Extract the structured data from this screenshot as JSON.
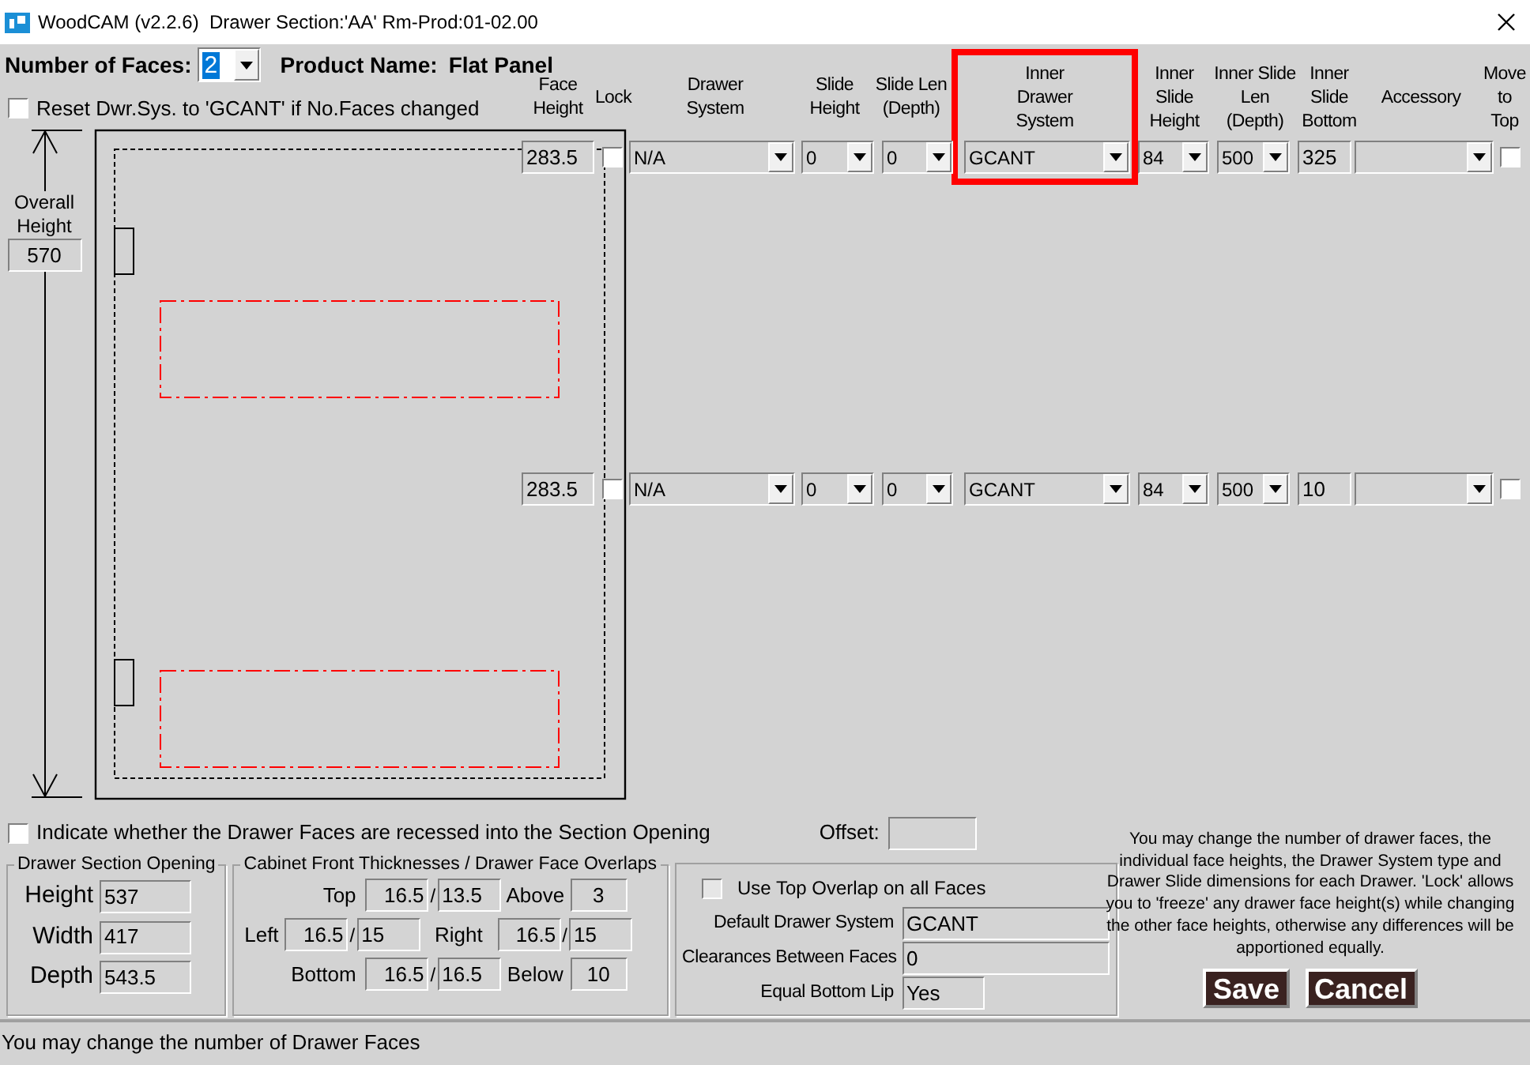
{
  "window": {
    "title": "WoodCAM (v2.2.6)  Drawer Section:'AA' Rm-Prod:01-02.00"
  },
  "number_of_faces": {
    "label": "Number of Faces:",
    "value": "2",
    "focused": true
  },
  "product_name": {
    "label": "Product Name:",
    "value": "Flat Panel"
  },
  "reset_option": {
    "label": "Reset Dwr.Sys. to 'GCANT' if No.Faces changed",
    "checked": false
  },
  "overall_height": {
    "label": "Overall Height",
    "value": "570"
  },
  "columns": [
    {
      "label": "Face\nHeight",
      "highlighted": false
    },
    {
      "label": "Lock",
      "highlighted": false
    },
    {
      "label": "Drawer\nSystem",
      "highlighted": false
    },
    {
      "label": "Slide\nHeight",
      "highlighted": false
    },
    {
      "label": "Slide Len\n(Depth)",
      "highlighted": false
    },
    {
      "label": "Inner\nDrawer\nSystem",
      "highlighted": true
    },
    {
      "label": "Inner\nSlide\nHeight",
      "highlighted": false
    },
    {
      "label": "Inner Slide\nLen\n(Depth)",
      "highlighted": false
    },
    {
      "label": "Inner\nSlide\nBottom",
      "highlighted": false
    },
    {
      "label": "Accessory",
      "highlighted": false
    },
    {
      "label": "Move\nto\nTop",
      "highlighted": false
    }
  ],
  "faces": [
    {
      "cells": [
        {
          "kind": "input",
          "value": "283.5"
        },
        {
          "kind": "checkbox",
          "checked": false
        },
        {
          "kind": "select",
          "value": "N/A"
        },
        {
          "kind": "select",
          "value": "0"
        },
        {
          "kind": "select",
          "value": "0"
        },
        {
          "kind": "select",
          "value": "GCANT"
        },
        {
          "kind": "select",
          "value": "84"
        },
        {
          "kind": "select",
          "value": "500"
        },
        {
          "kind": "input",
          "value": "325"
        },
        {
          "kind": "select"
        },
        {
          "kind": "checkbox",
          "checked": false
        }
      ]
    },
    {
      "cells": [
        {
          "kind": "input",
          "value": "283.5"
        },
        {
          "kind": "checkbox",
          "checked": false
        },
        {
          "kind": "select",
          "value": "N/A"
        },
        {
          "kind": "select",
          "value": "0"
        },
        {
          "kind": "select",
          "value": "0"
        },
        {
          "kind": "select",
          "value": "GCANT"
        },
        {
          "kind": "select",
          "value": "84"
        },
        {
          "kind": "select",
          "value": "500"
        },
        {
          "kind": "input",
          "value": "10"
        },
        {
          "kind": "select"
        },
        {
          "kind": "checkbox",
          "checked": false
        }
      ]
    }
  ],
  "recessed_option": {
    "label": "Indicate whether the Drawer Faces are recessed into the Section Opening",
    "checked": false
  },
  "offset": {
    "label": "Offset:"
  },
  "section_opening": {
    "title": "Drawer Section Opening",
    "fields": [
      {
        "label": "Height",
        "value": "537"
      },
      {
        "label": "Width",
        "value": "417"
      },
      {
        "label": "Depth",
        "value": "543.5"
      }
    ]
  },
  "front_thicknesses": {
    "title": "Cabinet Front Thicknesses / Drawer Face Overlaps",
    "top": {
      "label": "Top",
      "thickness": "16.5",
      "separator": "/",
      "overlap": "13.5"
    },
    "above": {
      "label": "Above",
      "value": "3"
    },
    "left": {
      "label": "Left",
      "thickness": "16.5",
      "separator": "/",
      "overlap": "15"
    },
    "right": {
      "label": "Right",
      "thickness": "16.5",
      "separator": "/",
      "overlap": "15"
    },
    "bottom": {
      "label": "Bottom",
      "thickness": "16.5",
      "separator": "/",
      "overlap": "16.5"
    },
    "below": {
      "label": "Below",
      "value": "10"
    }
  },
  "defaults": {
    "use_top_overlap": {
      "label": "Use Top Overlap on all Faces",
      "checked": false,
      "disabled": true
    },
    "fields": [
      {
        "label": "Default Drawer System",
        "value": "GCANT"
      },
      {
        "label": "Clearances Between Faces",
        "value": "0"
      },
      {
        "label": "Equal Bottom Lip",
        "value": "Yes"
      }
    ]
  },
  "help_text": "You may change the number of drawer faces, the individual face heights, the Drawer System type and Drawer Slide dimensions for each Drawer. 'Lock' allows you to 'freeze' any drawer face height(s) while changing the other face heights, otherwise any differences will be apportioned equally.",
  "buttons": [
    "Save",
    "Cancel"
  ],
  "status_bar": "You may change the number of Drawer Faces"
}
